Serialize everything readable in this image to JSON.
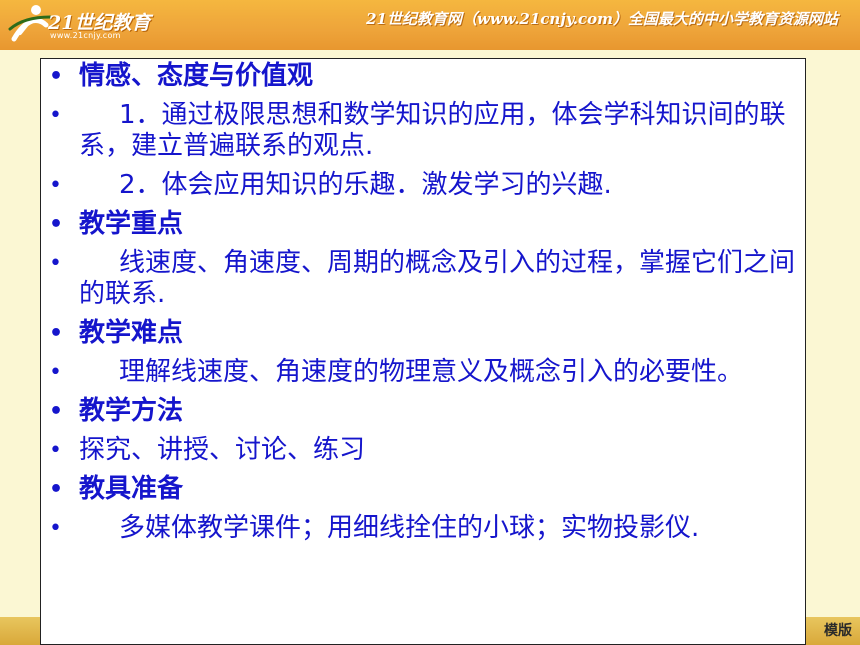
{
  "header": {
    "logo_text": "21世纪教育",
    "logo_url": "www.21cnjy.com",
    "tagline": "21世纪教育网（www.21cnjy.com）全国最大的中小学教育资源网站"
  },
  "footer": {
    "edition": "模版"
  },
  "colors": {
    "banner": "#eea43a",
    "background": "#fbf7d3",
    "text": "#1515cc",
    "footer_band": "#d9a83a"
  },
  "items": [
    {
      "type": "heading",
      "text": "情感、态度与价值观"
    },
    {
      "type": "body",
      "text": "1．通过极限思想和数学知识的应用，体会学科知识间的联系，建立普遍联系的观点."
    },
    {
      "type": "body",
      "text": "2．体会应用知识的乐趣．激发学习的兴趣."
    },
    {
      "type": "heading",
      "text": "教学重点"
    },
    {
      "type": "body",
      "text": "线速度、角速度、周期的概念及引入的过程，掌握它们之间的联系."
    },
    {
      "type": "heading",
      "text": "教学难点"
    },
    {
      "type": "body",
      "text": "理解线速度、角速度的物理意义及概念引入的必要性。"
    },
    {
      "type": "heading",
      "text": "教学方法"
    },
    {
      "type": "plain",
      "text": "探究、讲授、讨论、练习"
    },
    {
      "type": "heading",
      "text": "教具准备"
    },
    {
      "type": "body",
      "text": "多媒体教学课件；用细线拴住的小球；实物投影仪."
    }
  ]
}
